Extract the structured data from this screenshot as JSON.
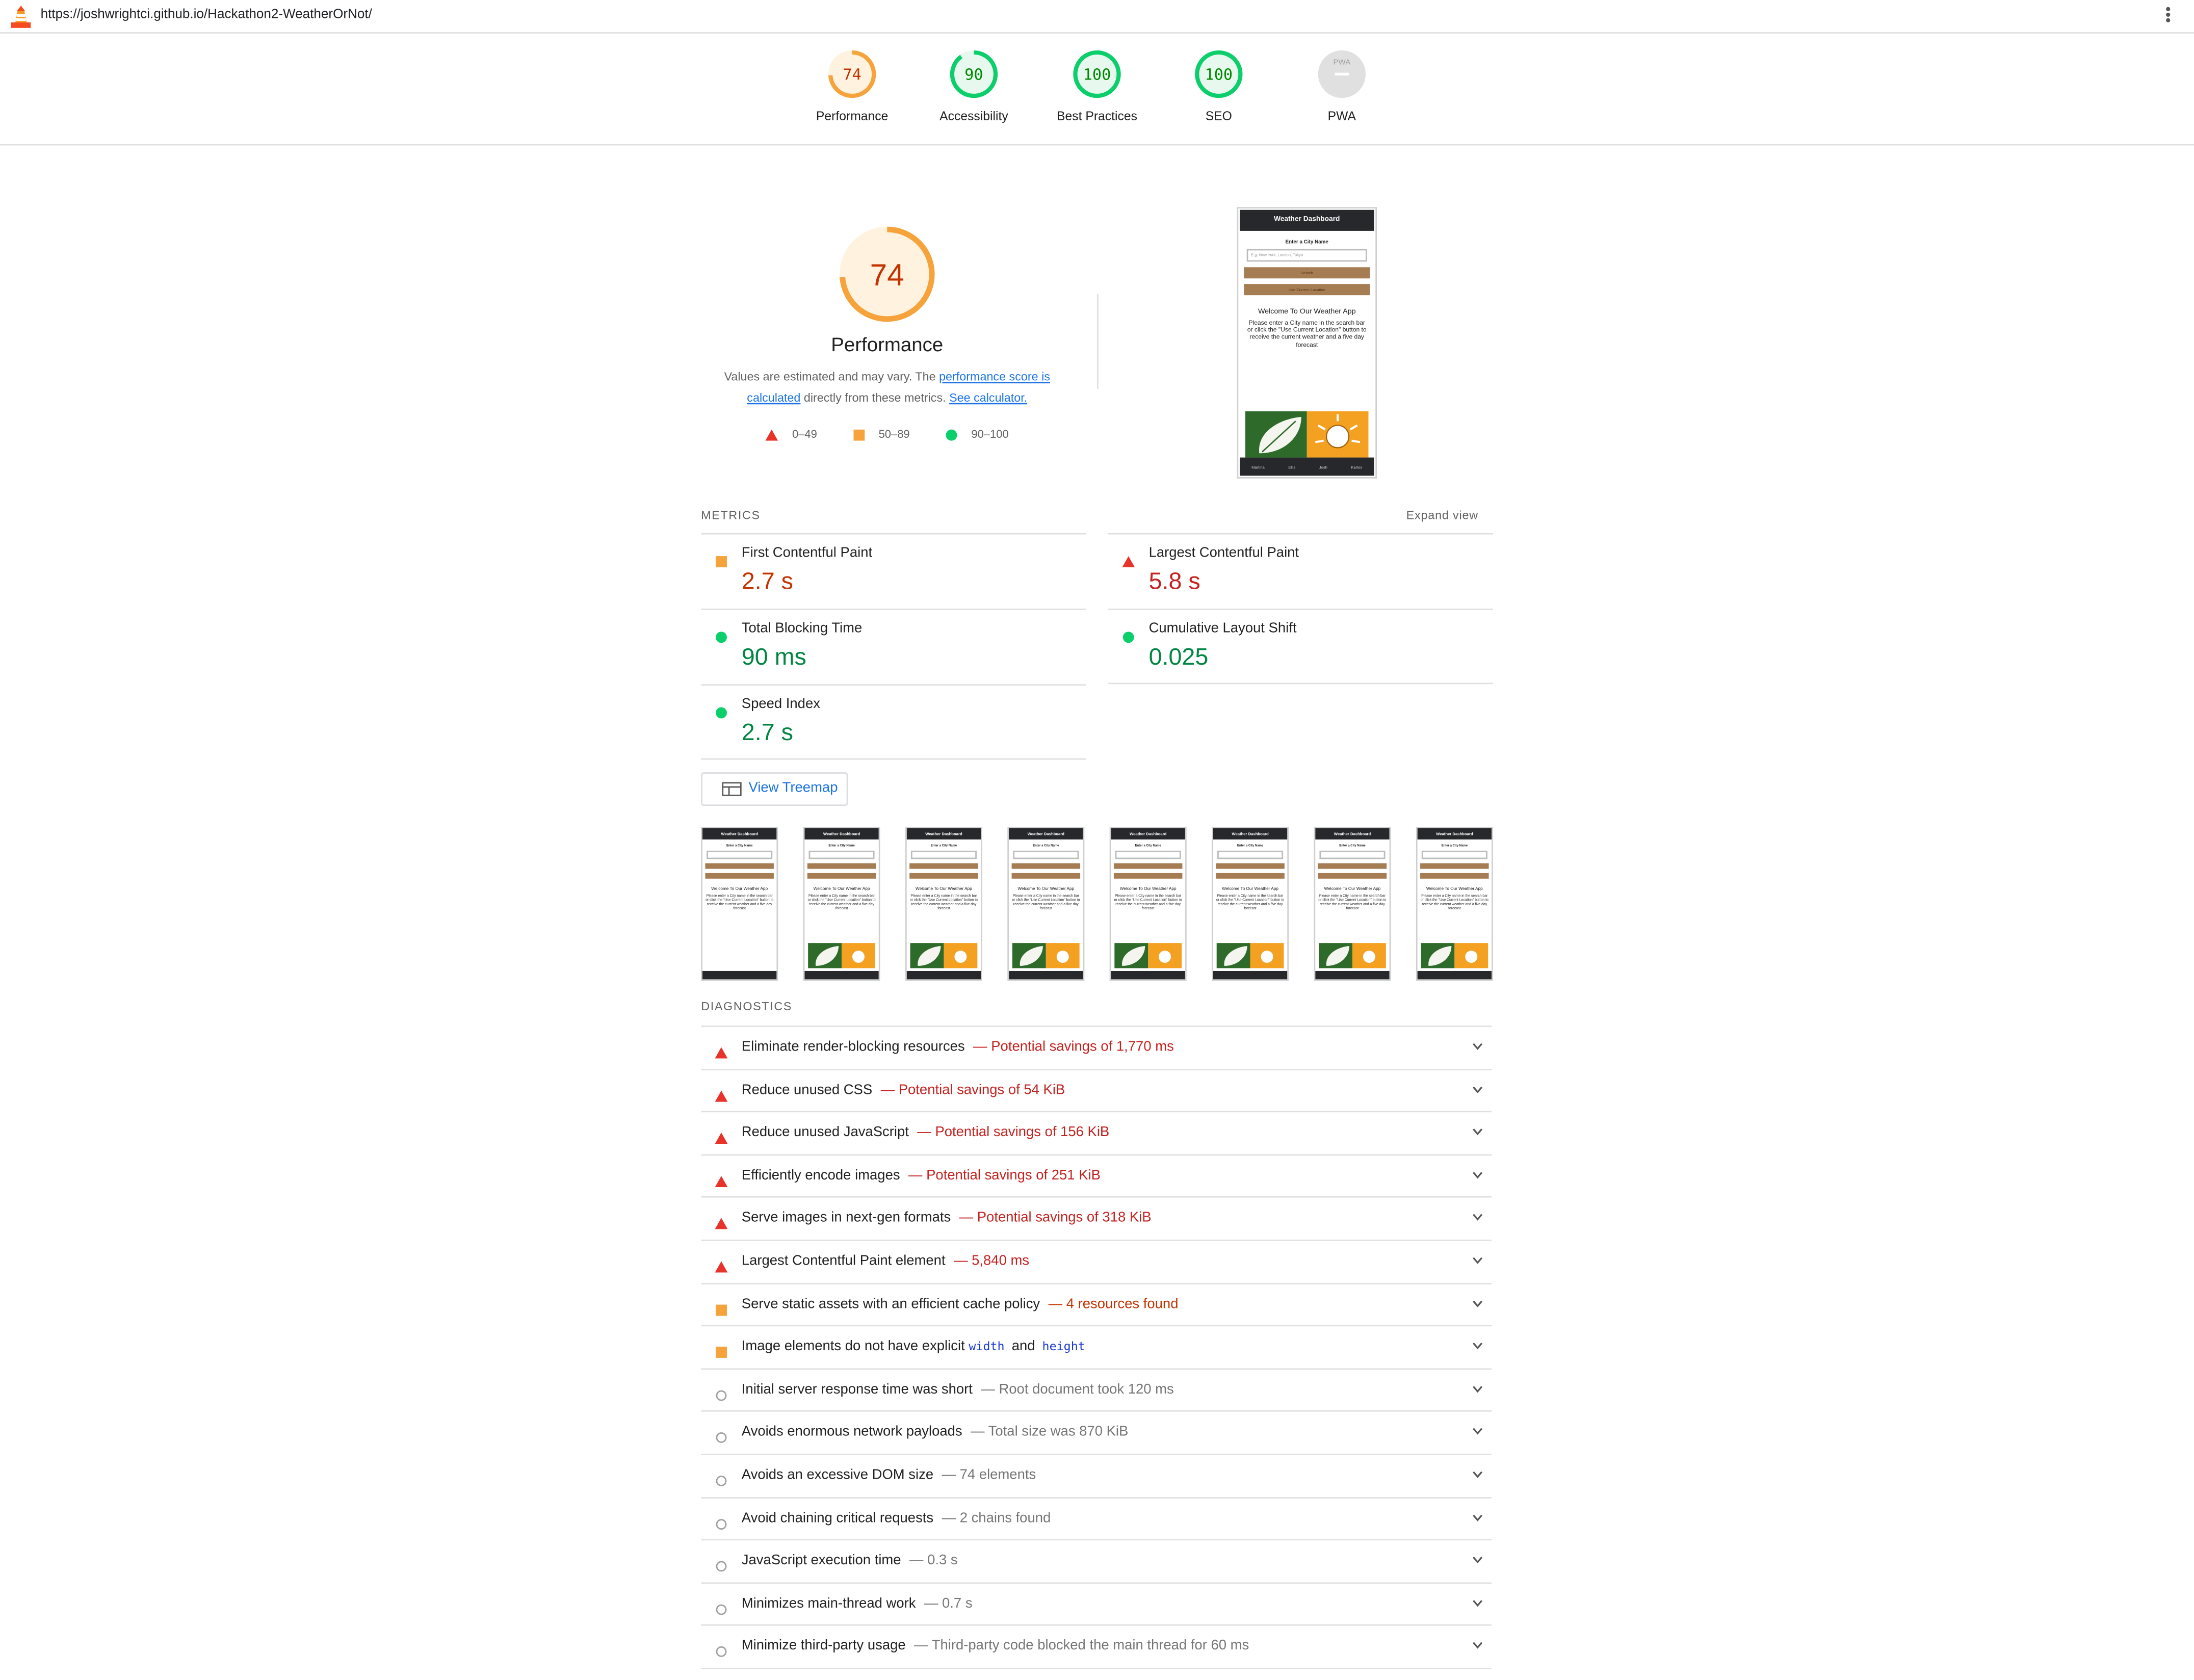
{
  "url": "https://joshwrightci.github.io/Hackathon2-WeatherOrNot/",
  "colors": {
    "fail": "#e8332b",
    "average": "#f6a33b",
    "pass": "#0cce6b",
    "link": "#1a73e8"
  },
  "scores": [
    {
      "value": "74",
      "label": "Performance",
      "score": 0.74,
      "rating": "average"
    },
    {
      "value": "90",
      "label": "Accessibility",
      "score": 0.9,
      "rating": "pass"
    },
    {
      "value": "100",
      "label": "Best Practices",
      "score": 1.0,
      "rating": "pass"
    },
    {
      "value": "100",
      "label": "SEO",
      "score": 1.0,
      "rating": "pass"
    },
    {
      "value": "PWA",
      "label": "PWA",
      "score": 0,
      "rating": "na"
    }
  ],
  "performance": {
    "score": "74",
    "title": "Performance",
    "desc_prefix": "Values are estimated and may vary. The ",
    "desc_link1": "performance score is calculated",
    "desc_mid": " directly from these metrics. ",
    "desc_link2": "See calculator.",
    "legend": [
      "0–49",
      "50–89",
      "90–100"
    ]
  },
  "screenshot": {
    "header": "Weather Dashboard",
    "label": "Enter a City Name",
    "placeholder": "E.g. New York, London, Tokyo",
    "search_btn": "Search",
    "location_btn": "Use Current Location",
    "welcome": "Welcome To Our Weather App",
    "text": "Please enter a City name in the search bar or click the \"Use Current Location\" button to receive the current weather and a five day forecast",
    "footer": [
      "Martina",
      "Ellis",
      "Josh",
      "Karlos"
    ]
  },
  "metrics": {
    "title": "METRICS",
    "expand": "Expand view",
    "items": [
      {
        "name": "First Contentful Paint",
        "value": "2.7 s",
        "rating": "average"
      },
      {
        "name": "Largest Contentful Paint",
        "value": "5.8 s",
        "rating": "fail"
      },
      {
        "name": "Total Blocking Time",
        "value": "90 ms",
        "rating": "pass"
      },
      {
        "name": "Cumulative Layout Shift",
        "value": "0.025",
        "rating": "pass"
      },
      {
        "name": "Speed Index",
        "value": "2.7 s",
        "rating": "pass"
      }
    ]
  },
  "treemap_label": "View Treemap",
  "filmstrip_count": 8,
  "diagnostics": {
    "title": "DIAGNOSTICS",
    "items": [
      {
        "title": "Eliminate render-blocking resources",
        "detail": "— Potential savings of 1,770 ms",
        "rating": "fail"
      },
      {
        "title": "Reduce unused CSS",
        "detail": "— Potential savings of 54 KiB",
        "rating": "fail"
      },
      {
        "title": "Reduce unused JavaScript",
        "detail": "— Potential savings of 156 KiB",
        "rating": "fail"
      },
      {
        "title": "Efficiently encode images",
        "detail": "— Potential savings of 251 KiB",
        "rating": "fail"
      },
      {
        "title": "Serve images in next-gen formats",
        "detail": "— Potential savings of 318 KiB",
        "rating": "fail"
      },
      {
        "title": "Largest Contentful Paint element",
        "detail": "— 5,840 ms",
        "rating": "fail"
      },
      {
        "title": "Serve static assets with an efficient cache policy",
        "detail": "— 4 resources found",
        "rating": "average"
      },
      {
        "title": "Image elements do not have explicit",
        "code1": "width",
        "and": "and",
        "code2": "height",
        "detail": "",
        "rating": "average"
      },
      {
        "title": "Initial server response time was short",
        "detail": "— Root document took 120 ms",
        "rating": "info"
      },
      {
        "title": "Avoids enormous network payloads",
        "detail": "— Total size was 870 KiB",
        "rating": "info"
      },
      {
        "title": "Avoids an excessive DOM size",
        "detail": "— 74 elements",
        "rating": "info"
      },
      {
        "title": "Avoid chaining critical requests",
        "detail": "— 2 chains found",
        "rating": "info"
      },
      {
        "title": "JavaScript execution time",
        "detail": "— 0.3 s",
        "rating": "info"
      },
      {
        "title": "Minimizes main-thread work",
        "detail": "— 0.7 s",
        "rating": "info"
      },
      {
        "title": "Minimize third-party usage",
        "detail": "— Third-party code blocked the main thread for 60 ms",
        "rating": "info"
      }
    ]
  }
}
